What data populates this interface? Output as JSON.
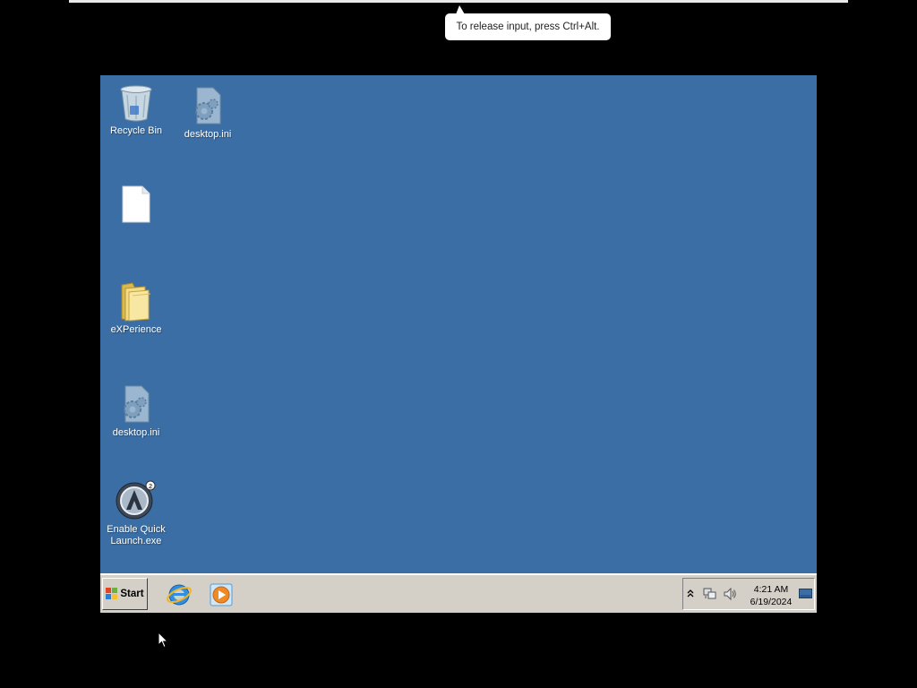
{
  "host": {
    "tooltip_text": "To release input, press Ctrl+Alt."
  },
  "desktop": {
    "background_color": "#3a6ea5",
    "icons": [
      {
        "label": "Recycle Bin",
        "icon": "recycle-bin-icon"
      },
      {
        "label": "desktop.ini",
        "icon": "settings-file-icon"
      },
      {
        "label": "",
        "icon": "blank-file-icon"
      },
      {
        "label": "eXPerience",
        "icon": "folder-icon"
      },
      {
        "label": "desktop.ini",
        "icon": "settings-file-icon"
      },
      {
        "label": "Enable Quick Launch.exe",
        "icon": "app-icon"
      }
    ]
  },
  "taskbar": {
    "start_label": "Start",
    "quick_launch": [
      {
        "name": "Internet Explorer",
        "icon": "internet-explorer-icon"
      },
      {
        "name": "Media Player",
        "icon": "media-player-icon"
      }
    ],
    "tray": {
      "time": "4:21 AM",
      "date": "6/19/2024",
      "icons": [
        "expand-tray-icon",
        "network-icon",
        "volume-icon",
        "show-desktop-icon"
      ]
    }
  }
}
